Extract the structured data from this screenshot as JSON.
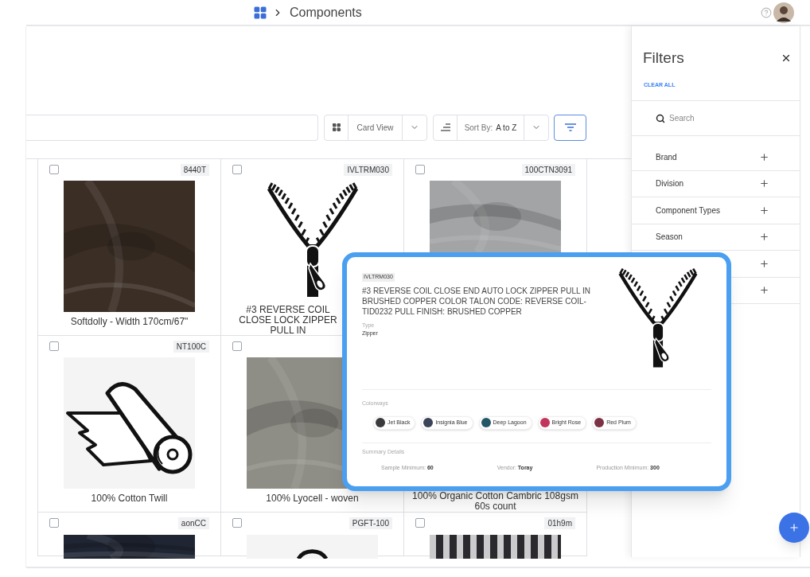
{
  "header": {
    "title": "Components"
  },
  "toolbar": {
    "view": "Card View",
    "sort_label": "Sort By:",
    "sort_value": "A to Z"
  },
  "cards": [
    {
      "code": "8440T",
      "title": "Softdolly - Width 170cm/67\"",
      "checked": false,
      "color": "#3b2e25"
    },
    {
      "code": "IVLTRM030",
      "title": "#3 REVERSE COIL CLOSE LOCK ZIPPER PULL IN",
      "checked": false,
      "kind": "zipper"
    },
    {
      "code": "100CTN3091",
      "checked": false,
      "color": "#a3a4a6"
    },
    {
      "code": "NT100C",
      "title": "100% Cotton Twill",
      "checked": false,
      "kind": "roll"
    },
    {
      "title": "100% Lyocell - woven",
      "checked": false,
      "color": "#8f8e86"
    },
    {
      "title": "100% Organic Cotton Cambric 108gsm 60s count",
      "kind": "blank"
    },
    {
      "code": "aonCC",
      "checked": false,
      "color": "#1f2533"
    },
    {
      "code": "PGFT-100",
      "checked": false,
      "kind": "ring"
    },
    {
      "code": "01h9m",
      "checked": false,
      "kind": "check",
      "color": "#2a2a2e"
    }
  ],
  "filters": {
    "title": "Filters",
    "clear": "CLEAR ALL",
    "search_placeholder": "Search",
    "items": [
      {
        "label": "Brand",
        "expanded": false
      },
      {
        "label": "Division",
        "expanded": false
      },
      {
        "label": "Component Types",
        "expanded": false
      },
      {
        "label": "Season",
        "expanded": false
      },
      {
        "expanded": false
      },
      {
        "expanded": false
      }
    ]
  },
  "popup": {
    "code": "IVLTRM030",
    "title": "#3 REVERSE COIL CLOSE END AUTO LOCK ZIPPER PULL IN BRUSHED COPPER COLOR TALON CODE: REVERSE COIL-TID0232 PULL FINISH: BRUSHED COPPER",
    "type_label": "Type",
    "type_value": "Zipper",
    "colorways_label": "Colorways",
    "colorways": [
      {
        "name": "Jet Black",
        "color": "#3a3a3d"
      },
      {
        "name": "Insignia Blue",
        "color": "#3b4358"
      },
      {
        "name": "Deep Lagoon",
        "color": "#245766"
      },
      {
        "name": "Bright Rose",
        "color": "#c2365e"
      },
      {
        "name": "Red Plum",
        "color": "#7c3145"
      }
    ],
    "summary_label": "Summary Details",
    "summary": [
      {
        "label": "Sample Minimum:",
        "value": "60"
      },
      {
        "label": "Vendor:",
        "value": "Toray"
      },
      {
        "label": "Production Minimum:",
        "value": "300"
      }
    ]
  }
}
